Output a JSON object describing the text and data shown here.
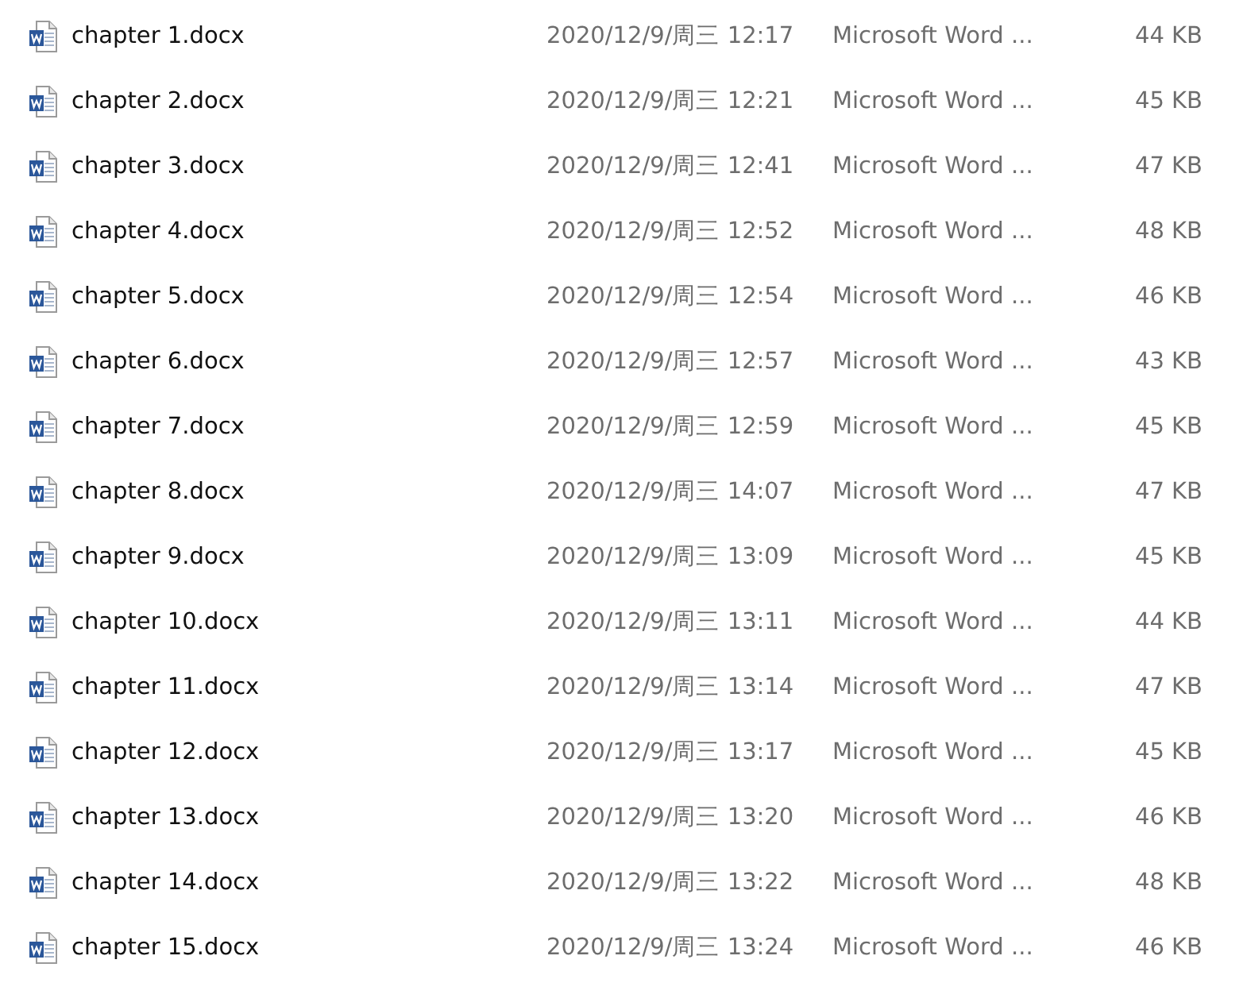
{
  "files": [
    {
      "name": "chapter 1.docx",
      "modified": "2020/12/9/周三 12:17",
      "type": "Microsoft Word ...",
      "size": "44 KB"
    },
    {
      "name": "chapter 2.docx",
      "modified": "2020/12/9/周三 12:21",
      "type": "Microsoft Word ...",
      "size": "45 KB"
    },
    {
      "name": "chapter 3.docx",
      "modified": "2020/12/9/周三 12:41",
      "type": "Microsoft Word ...",
      "size": "47 KB"
    },
    {
      "name": "chapter 4.docx",
      "modified": "2020/12/9/周三 12:52",
      "type": "Microsoft Word ...",
      "size": "48 KB"
    },
    {
      "name": "chapter 5.docx",
      "modified": "2020/12/9/周三 12:54",
      "type": "Microsoft Word ...",
      "size": "46 KB"
    },
    {
      "name": "chapter 6.docx",
      "modified": "2020/12/9/周三 12:57",
      "type": "Microsoft Word ...",
      "size": "43 KB"
    },
    {
      "name": "chapter 7.docx",
      "modified": "2020/12/9/周三 12:59",
      "type": "Microsoft Word ...",
      "size": "45 KB"
    },
    {
      "name": "chapter 8.docx",
      "modified": "2020/12/9/周三 14:07",
      "type": "Microsoft Word ...",
      "size": "47 KB"
    },
    {
      "name": "chapter 9.docx",
      "modified": "2020/12/9/周三 13:09",
      "type": "Microsoft Word ...",
      "size": "45 KB"
    },
    {
      "name": "chapter 10.docx",
      "modified": "2020/12/9/周三 13:11",
      "type": "Microsoft Word ...",
      "size": "44 KB"
    },
    {
      "name": "chapter 11.docx",
      "modified": "2020/12/9/周三 13:14",
      "type": "Microsoft Word ...",
      "size": "47 KB"
    },
    {
      "name": "chapter 12.docx",
      "modified": "2020/12/9/周三 13:17",
      "type": "Microsoft Word ...",
      "size": "45 KB"
    },
    {
      "name": "chapter 13.docx",
      "modified": "2020/12/9/周三 13:20",
      "type": "Microsoft Word ...",
      "size": "46 KB"
    },
    {
      "name": "chapter 14.docx",
      "modified": "2020/12/9/周三 13:22",
      "type": "Microsoft Word ...",
      "size": "48 KB"
    },
    {
      "name": "chapter 15.docx",
      "modified": "2020/12/9/周三 13:24",
      "type": "Microsoft Word ...",
      "size": "46 KB"
    }
  ]
}
